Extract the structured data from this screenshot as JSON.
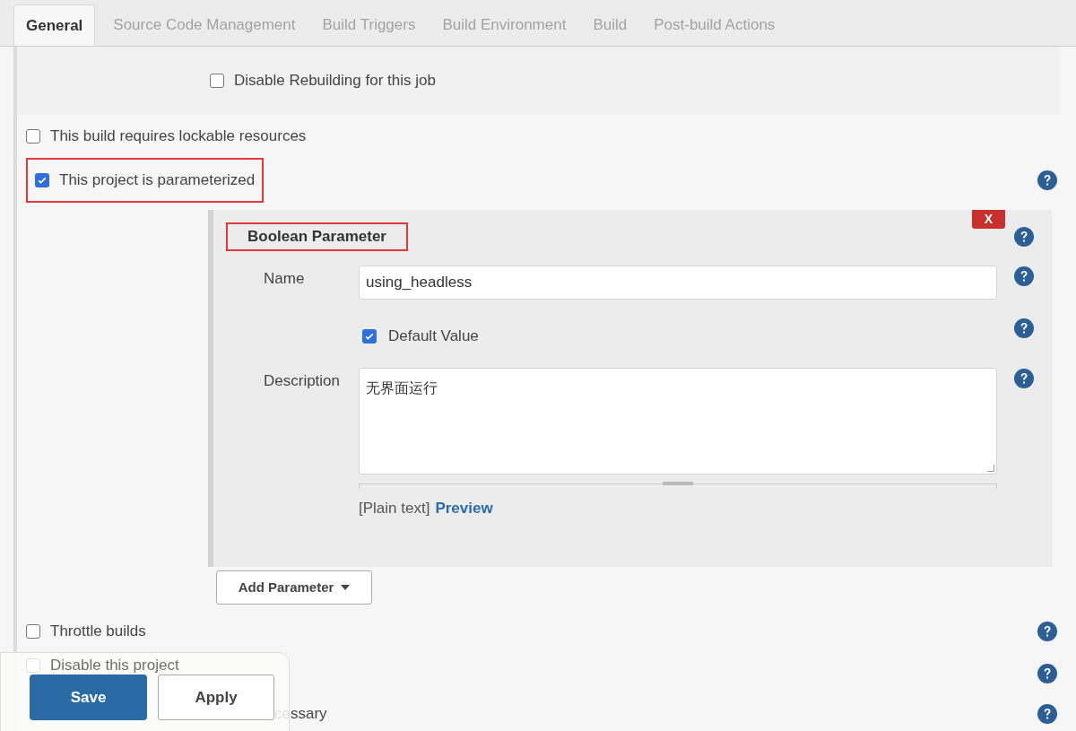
{
  "tabs": [
    {
      "label": "General",
      "selected": true
    },
    {
      "label": "Source Code Management",
      "selected": false
    },
    {
      "label": "Build Triggers",
      "selected": false
    },
    {
      "label": "Build Environment",
      "selected": false
    },
    {
      "label": "Build",
      "selected": false
    },
    {
      "label": "Post-build Actions",
      "selected": false
    }
  ],
  "top_options": [
    {
      "kind": "indented",
      "label": "Disable Rebuilding for this job",
      "checked": false,
      "highlighted": false,
      "help": false
    },
    {
      "kind": "plain",
      "label": "This build requires lockable resources",
      "checked": false,
      "highlighted": false,
      "help": false
    },
    {
      "kind": "plain",
      "label": "This project is parameterized",
      "checked": true,
      "highlighted": true,
      "help": true
    }
  ],
  "parameter": {
    "title": "Boolean Parameter",
    "highlighted": true,
    "delete_button": "X",
    "name_label": "Name",
    "name_value": "using_headless",
    "default_label": "Default Value",
    "default_checked": true,
    "description_label": "Description",
    "description_value": "无界面运行",
    "format_note": "[Plain text]",
    "preview_link": "Preview"
  },
  "add_parameter_button": "Add Parameter",
  "bottom_options": [
    {
      "kind": "plain",
      "label": "Throttle builds",
      "checked": false,
      "help": true
    },
    {
      "kind": "faded",
      "label": "Disable this project",
      "checked": false,
      "help": true
    },
    {
      "kind": "partial",
      "label": "cessary",
      "help": true
    }
  ],
  "save_bar": {
    "save": "Save",
    "apply": "Apply"
  }
}
